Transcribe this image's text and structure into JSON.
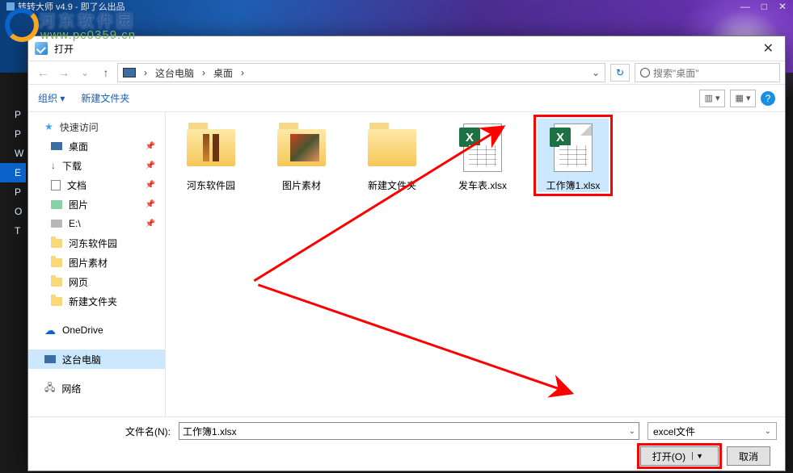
{
  "app": {
    "title": "转转大师 v4.9 - 即了么出品",
    "minimize": "—",
    "maximize": "□",
    "close": "✕"
  },
  "watermark": {
    "name": "河东软件园",
    "url": "www.pc0359.cn"
  },
  "left_peek": [
    "P",
    "P",
    "W",
    "E",
    "P",
    "O",
    "",
    "T"
  ],
  "dialog": {
    "title": "打开",
    "close": "✕",
    "nav": {
      "back": "←",
      "fwd": "→",
      "up": "↑"
    },
    "path": {
      "root": "这台电脑",
      "seg1": "桌面",
      "sep": "›"
    },
    "refresh": "↻",
    "search_placeholder": "搜索\"桌面\"",
    "toolbar": {
      "organize": "组织 ▾",
      "newfolder": "新建文件夹",
      "view1": "▥ ▾",
      "view2": "▦ ▾",
      "help": "?"
    },
    "sidebar": {
      "quick": "快速访问",
      "items": [
        {
          "label": "桌面",
          "icon": "monitor",
          "pin": true
        },
        {
          "label": "下载",
          "icon": "dl",
          "pin": true
        },
        {
          "label": "文档",
          "icon": "doc",
          "pin": true
        },
        {
          "label": "图片",
          "icon": "pics",
          "pin": true
        },
        {
          "label": "E:\\",
          "icon": "drive",
          "pin": true
        },
        {
          "label": "河东软件园",
          "icon": "folder",
          "pin": false
        },
        {
          "label": "图片素材",
          "icon": "folder",
          "pin": false
        },
        {
          "label": "网页",
          "icon": "folder",
          "pin": false
        },
        {
          "label": "新建文件夹",
          "icon": "folder",
          "pin": false
        }
      ],
      "onedrive": "OneDrive",
      "thispc": "这台电脑",
      "network": "网络"
    },
    "files": [
      {
        "name": "河东软件园",
        "type": "folder",
        "variant": "stripe1"
      },
      {
        "name": "图片素材",
        "type": "folder",
        "variant": "stripe2"
      },
      {
        "name": "新建文件夹",
        "type": "folder",
        "variant": "plain"
      },
      {
        "name": "发车表.xlsx",
        "type": "xlsx"
      },
      {
        "name": "工作簿1.xlsx",
        "type": "xlsx",
        "selected": true,
        "highlight": true
      }
    ],
    "footer": {
      "fn_label": "文件名(N):",
      "fn_value": "工作簿1.xlsx",
      "filter": "excel文件",
      "open": "打开(O)",
      "cancel": "取消"
    }
  }
}
